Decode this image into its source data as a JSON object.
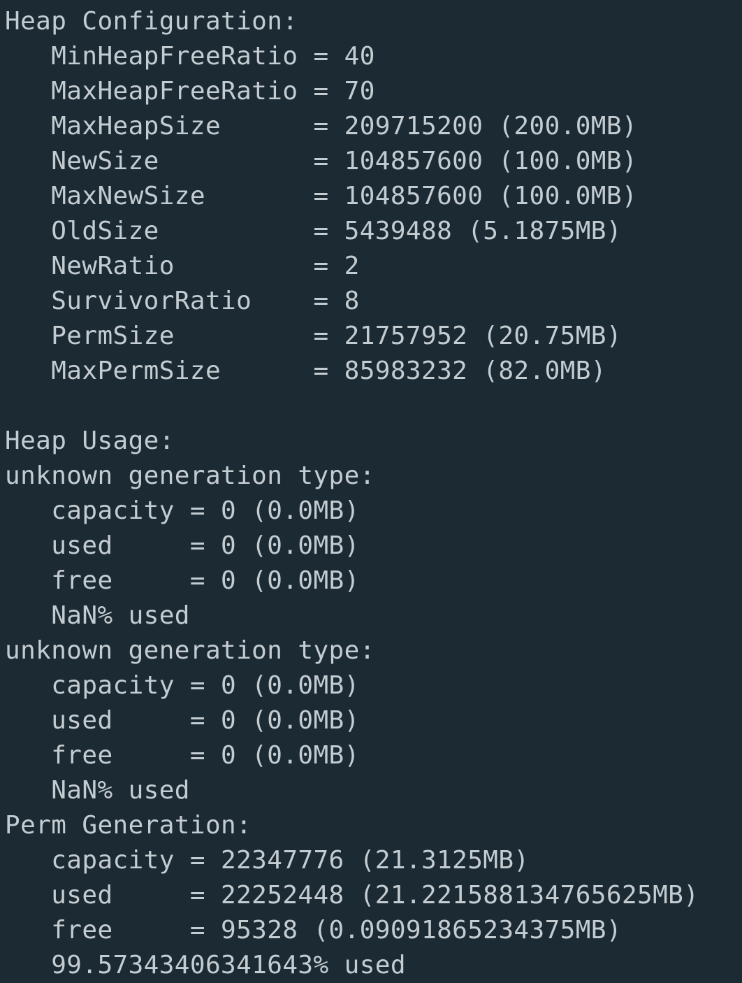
{
  "terminal": {
    "lines": [
      "Heap Configuration:",
      "   MinHeapFreeRatio = 40",
      "   MaxHeapFreeRatio = 70",
      "   MaxHeapSize      = 209715200 (200.0MB)",
      "   NewSize          = 104857600 (100.0MB)",
      "   MaxNewSize       = 104857600 (100.0MB)",
      "   OldSize          = 5439488 (5.1875MB)",
      "   NewRatio         = 2",
      "   SurvivorRatio    = 8",
      "   PermSize         = 21757952 (20.75MB)",
      "   MaxPermSize      = 85983232 (82.0MB)",
      "",
      "Heap Usage:",
      "unknown generation type:",
      "   capacity = 0 (0.0MB)",
      "   used     = 0 (0.0MB)",
      "   free     = 0 (0.0MB)",
      "   NaN% used",
      "unknown generation type:",
      "   capacity = 0 (0.0MB)",
      "   used     = 0 (0.0MB)",
      "   free     = 0 (0.0MB)",
      "   NaN% used",
      "Perm Generation:",
      "   capacity = 22347776 (21.3125MB)",
      "   used     = 22252448 (21.221588134765625MB)",
      "   free     = 95328 (0.09091865234375MB)",
      "   99.57343406341643% used"
    ]
  }
}
